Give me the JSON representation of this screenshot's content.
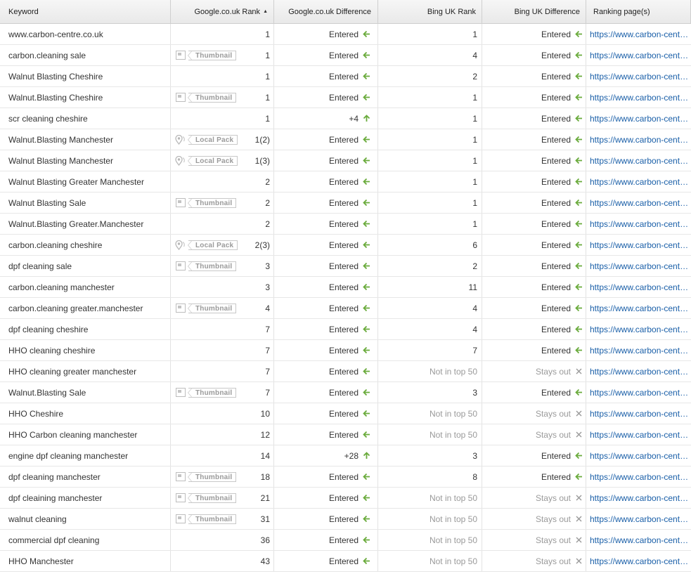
{
  "headers": {
    "keyword": "Keyword",
    "google_rank": "Google.co.uk Rank",
    "google_diff": "Google.co.uk Difference",
    "bing_rank": "Bing UK Rank",
    "bing_diff": "Bing UK Difference",
    "ranking_page": "Ranking page(s)"
  },
  "sort": {
    "column": "google_rank",
    "direction": "ascending"
  },
  "colors": {
    "entered_arrow": "#6aab3c",
    "stays_out_x": "#999999",
    "link": "#1a5fa8",
    "muted": "#9a9a9a"
  },
  "feature_labels": {
    "thumbnail": "Thumbnail",
    "local_pack": "Local Pack"
  },
  "feature_icons": {
    "thumbnail": "thumbnail-icon",
    "local_pack": "map-pin-icon"
  },
  "rows": [
    {
      "keyword": "www.carbon-centre.co.uk",
      "feature": "",
      "g_rank": "1",
      "g_diff": "Entered",
      "g_icon": "left",
      "b_rank": "1",
      "b_diff": "Entered",
      "b_icon": "left",
      "url": "https://www.carbon-centre.co.uk/"
    },
    {
      "keyword": "carbon.cleaning sale",
      "feature": "thumbnail",
      "g_rank": "1",
      "g_diff": "Entered",
      "g_icon": "left",
      "b_rank": "4",
      "b_diff": "Entered",
      "b_icon": "left",
      "url": "https://www.carbon-centre.co.uk/"
    },
    {
      "keyword": "Walnut Blasting Cheshire",
      "feature": "",
      "g_rank": "1",
      "g_diff": "Entered",
      "g_icon": "left",
      "b_rank": "2",
      "b_diff": "Entered",
      "b_icon": "left",
      "url": "https://www.carbon-centre.co.uk/"
    },
    {
      "keyword": "Walnut.Blasting Cheshire",
      "feature": "thumbnail",
      "g_rank": "1",
      "g_diff": "Entered",
      "g_icon": "left",
      "b_rank": "1",
      "b_diff": "Entered",
      "b_icon": "left",
      "url": "https://www.carbon-centre.co.uk/"
    },
    {
      "keyword": "scr cleaning cheshire",
      "feature": "",
      "g_rank": "1",
      "g_diff": "+4",
      "g_icon": "up",
      "b_rank": "1",
      "b_diff": "Entered",
      "b_icon": "left",
      "url": "https://www.carbon-centre.co.uk/"
    },
    {
      "keyword": "Walnut.Blasting Manchester",
      "feature": "local_pack",
      "g_rank": "1(2)",
      "g_diff": "Entered",
      "g_icon": "left",
      "b_rank": "1",
      "b_diff": "Entered",
      "b_icon": "left",
      "url": "https://www.carbon-centre.co.uk/"
    },
    {
      "keyword": "Walnut Blasting Manchester",
      "feature": "local_pack",
      "g_rank": "1(3)",
      "g_diff": "Entered",
      "g_icon": "left",
      "b_rank": "1",
      "b_diff": "Entered",
      "b_icon": "left",
      "url": "https://www.carbon-centre.co.uk/"
    },
    {
      "keyword": "Walnut Blasting Greater Manchester",
      "feature": "",
      "g_rank": "2",
      "g_diff": "Entered",
      "g_icon": "left",
      "b_rank": "1",
      "b_diff": "Entered",
      "b_icon": "left",
      "url": "https://www.carbon-centre.co.uk/"
    },
    {
      "keyword": "Walnut Blasting Sale",
      "feature": "thumbnail",
      "g_rank": "2",
      "g_diff": "Entered",
      "g_icon": "left",
      "b_rank": "1",
      "b_diff": "Entered",
      "b_icon": "left",
      "url": "https://www.carbon-centre.co.uk/"
    },
    {
      "keyword": "Walnut.Blasting Greater.Manchester",
      "feature": "",
      "g_rank": "2",
      "g_diff": "Entered",
      "g_icon": "left",
      "b_rank": "1",
      "b_diff": "Entered",
      "b_icon": "left",
      "url": "https://www.carbon-centre.co.uk/"
    },
    {
      "keyword": "carbon.cleaning cheshire",
      "feature": "local_pack",
      "g_rank": "2(3)",
      "g_diff": "Entered",
      "g_icon": "left",
      "b_rank": "6",
      "b_diff": "Entered",
      "b_icon": "left",
      "url": "https://www.carbon-centre.co.uk/"
    },
    {
      "keyword": "dpf cleaning sale",
      "feature": "thumbnail",
      "g_rank": "3",
      "g_diff": "Entered",
      "g_icon": "left",
      "b_rank": "2",
      "b_diff": "Entered",
      "b_icon": "left",
      "url": "https://www.carbon-centre.co.uk/"
    },
    {
      "keyword": "carbon.cleaning manchester",
      "feature": "",
      "g_rank": "3",
      "g_diff": "Entered",
      "g_icon": "left",
      "b_rank": "11",
      "b_diff": "Entered",
      "b_icon": "left",
      "url": "https://www.carbon-centre.co.uk/"
    },
    {
      "keyword": "carbon.cleaning greater.manchester",
      "feature": "thumbnail",
      "g_rank": "4",
      "g_diff": "Entered",
      "g_icon": "left",
      "b_rank": "4",
      "b_diff": "Entered",
      "b_icon": "left",
      "url": "https://www.carbon-centre.co.uk/"
    },
    {
      "keyword": "dpf cleaning cheshire",
      "feature": "",
      "g_rank": "7",
      "g_diff": "Entered",
      "g_icon": "left",
      "b_rank": "4",
      "b_diff": "Entered",
      "b_icon": "left",
      "url": "https://www.carbon-centre.co.uk/"
    },
    {
      "keyword": "HHO cleaning cheshire",
      "feature": "",
      "g_rank": "7",
      "g_diff": "Entered",
      "g_icon": "left",
      "b_rank": "7",
      "b_diff": "Entered",
      "b_icon": "left",
      "url": "https://www.carbon-centre.co.uk/"
    },
    {
      "keyword": "HHO cleaning greater manchester",
      "feature": "",
      "g_rank": "7",
      "g_diff": "Entered",
      "g_icon": "left",
      "b_rank": "Not in top 50",
      "b_diff": "Stays out",
      "b_icon": "x",
      "url": "https://www.carbon-centre.co.uk/"
    },
    {
      "keyword": "Walnut.Blasting Sale",
      "feature": "thumbnail",
      "g_rank": "7",
      "g_diff": "Entered",
      "g_icon": "left",
      "b_rank": "3",
      "b_diff": "Entered",
      "b_icon": "left",
      "url": "https://www.carbon-centre.co.uk/"
    },
    {
      "keyword": "HHO Cheshire",
      "feature": "",
      "g_rank": "10",
      "g_diff": "Entered",
      "g_icon": "left",
      "b_rank": "Not in top 50",
      "b_diff": "Stays out",
      "b_icon": "x",
      "url": "https://www.carbon-centre.co.uk/"
    },
    {
      "keyword": "HHO Carbon cleaning manchester",
      "feature": "",
      "g_rank": "12",
      "g_diff": "Entered",
      "g_icon": "left",
      "b_rank": "Not in top 50",
      "b_diff": "Stays out",
      "b_icon": "x",
      "url": "https://www.carbon-centre.co.uk/"
    },
    {
      "keyword": "engine dpf cleaning manchester",
      "feature": "",
      "g_rank": "14",
      "g_diff": "+28",
      "g_icon": "up",
      "b_rank": "3",
      "b_diff": "Entered",
      "b_icon": "left",
      "url": "https://www.carbon-centre.co.uk/"
    },
    {
      "keyword": "dpf cleaning manchester",
      "feature": "thumbnail",
      "g_rank": "18",
      "g_diff": "Entered",
      "g_icon": "left",
      "b_rank": "8",
      "b_diff": "Entered",
      "b_icon": "left",
      "url": "https://www.carbon-centre.co.uk/"
    },
    {
      "keyword": "dpf cleaining manchester",
      "feature": "thumbnail",
      "g_rank": "21",
      "g_diff": "Entered",
      "g_icon": "left",
      "b_rank": "Not in top 50",
      "b_diff": "Stays out",
      "b_icon": "x",
      "url": "https://www.carbon-centre.co.uk/"
    },
    {
      "keyword": "walnut cleaning",
      "feature": "thumbnail",
      "g_rank": "31",
      "g_diff": "Entered",
      "g_icon": "left",
      "b_rank": "Not in top 50",
      "b_diff": "Stays out",
      "b_icon": "x",
      "url": "https://www.carbon-centre.co.uk/"
    },
    {
      "keyword": "commercial dpf cleaning",
      "feature": "",
      "g_rank": "36",
      "g_diff": "Entered",
      "g_icon": "left",
      "b_rank": "Not in top 50",
      "b_diff": "Stays out",
      "b_icon": "x",
      "url": "https://www.carbon-centre.co.uk/"
    },
    {
      "keyword": "HHO Manchester",
      "feature": "",
      "g_rank": "43",
      "g_diff": "Entered",
      "g_icon": "left",
      "b_rank": "Not in top 50",
      "b_diff": "Stays out",
      "b_icon": "x",
      "url": "https://www.carbon-centre.co.uk/"
    }
  ]
}
